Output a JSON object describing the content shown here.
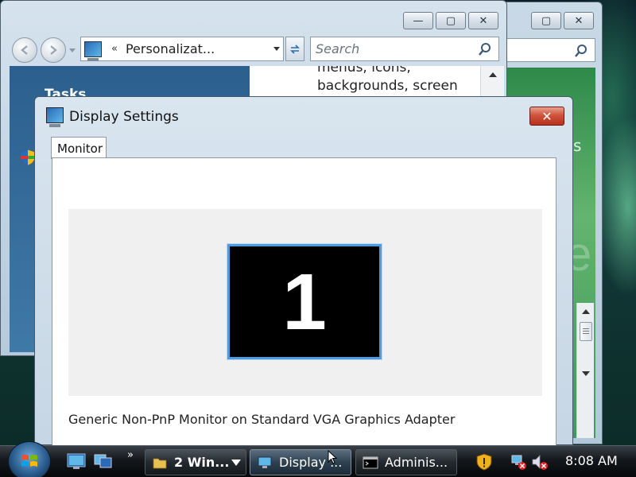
{
  "explorer": {
    "address_path": "Personalizat...",
    "address_chevron": "«",
    "search_placeholder": "Search",
    "tasks_title": "Tasks",
    "content_lines": [
      "menus, icons,",
      "backgrounds, screen"
    ],
    "controls": {
      "minimize": "—",
      "maximize": "▢",
      "close": "✕"
    }
  },
  "back_window": {
    "partial_text": "s",
    "controls": {
      "maximize": "▢",
      "close": "✕"
    }
  },
  "dialog": {
    "title": "Display Settings",
    "close_label": "✕",
    "tab_label": "Monitor",
    "monitor_number": "1",
    "monitor_description": "Generic Non-PnP Monitor on Standard VGA Graphics Adapter"
  },
  "taskbar": {
    "quicklaunch_more": "»",
    "buttons": [
      {
        "label": "2 Win...",
        "icon": "folder-icon",
        "has_dropdown": true
      },
      {
        "label": "Display ...",
        "icon": "display-settings-icon",
        "active": true
      },
      {
        "label": "Adminis...",
        "icon": "command-prompt-icon"
      }
    ],
    "tray": [
      "security-shield-icon",
      "network-disconnected-icon",
      "volume-muted-icon"
    ],
    "clock": "8:08 AM"
  },
  "colors": {
    "selection_blue": "#4d9be0",
    "close_red": "#c63b23",
    "tasks_pane_blue": "#2b5f8e",
    "desktop_green": "#3f9a5c"
  }
}
